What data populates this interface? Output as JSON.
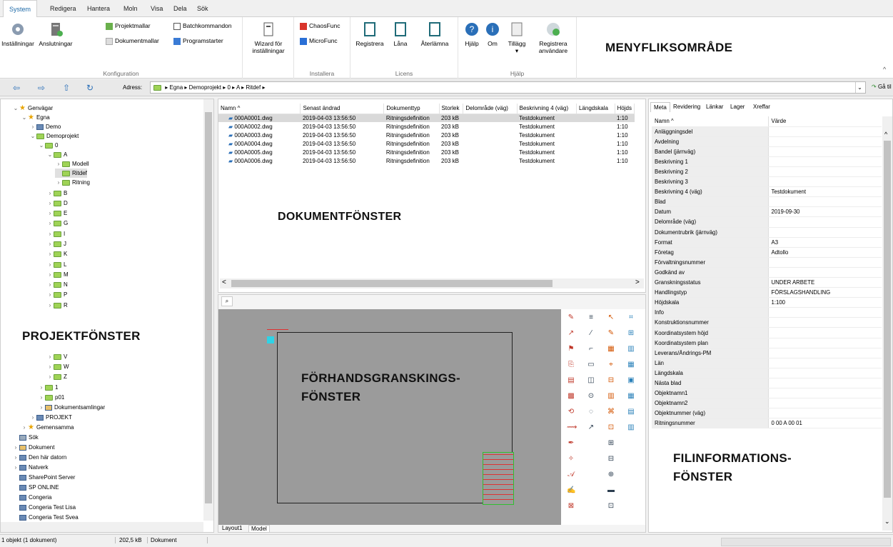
{
  "ribbon": {
    "tabs": [
      "System",
      "Redigera",
      "Hantera",
      "Moln",
      "Visa",
      "Dela",
      "Sök"
    ],
    "groups": {
      "konfiguration": {
        "label": "Konfiguration",
        "installningar": "Inställningar",
        "anslutningar": "Anslutningar",
        "projektmallar": "Projektmallar",
        "dokumentmallar": "Dokumentmallar",
        "batchkommandon": "Batchkommandon",
        "programstarter": "Programstarter"
      },
      "wizard": {
        "line1": "Wizard för",
        "line2": "inställningar"
      },
      "installera": {
        "label": "Installera",
        "chaosfunc": "ChaosFunc",
        "microfunc": "MicroFunc"
      },
      "licens": {
        "label": "Licens",
        "registrera": "Registrera",
        "lana": "Låna",
        "aterlamna": "Återlämna"
      },
      "hjalp": {
        "label": "Hjälp",
        "hjalp": "Hjälp",
        "om": "Om",
        "tillagg": "Tillägg",
        "reg1": "Registrera",
        "reg2": "användare"
      }
    },
    "overlay": "MENYFLIKSOMRÅDE"
  },
  "nav": {
    "address_label": "Adress:",
    "path": [
      "Egna",
      "Demoprojekt",
      "0",
      "A",
      "Ritdef"
    ],
    "goto": "Gå til"
  },
  "tree": {
    "items": [
      "Genvägar",
      "Egna",
      "Demo",
      "Demoprojekt",
      "0",
      "A",
      "Modell",
      "Ritdef",
      "Ritning",
      "B",
      "D",
      "E",
      "G",
      "I",
      "J",
      "K",
      "L",
      "M",
      "N",
      "P",
      "R",
      "V",
      "W",
      "Z",
      "1",
      "p01",
      "Dokumentsamlingar",
      "PROJEKT",
      "Gemensamma",
      "Sök",
      "Dokument",
      "Den här datorn",
      "Natverk",
      "SharePoint Server",
      "SP ONLINE",
      "Congeria",
      "Congeria Test Lisa",
      "Congeria Test Svea"
    ],
    "overlay": "PROJEKTFÖNSTER"
  },
  "docs": {
    "columns": [
      "Namn",
      "Senast ändrad",
      "Dokumenttyp",
      "Storlek",
      "Delområde (väg)",
      "Beskrivning 4 (väg)",
      "Längdskala",
      "Höjds"
    ],
    "rows": [
      [
        "000A0001.dwg",
        "2019-04-03 13:56:50",
        "Ritningsdefinition",
        "203 kB",
        "",
        "Testdokument",
        "",
        "1:10"
      ],
      [
        "000A0002.dwg",
        "2019-04-03 13:56:50",
        "Ritningsdefinition",
        "203 kB",
        "",
        "Testdokument",
        "",
        "1:10"
      ],
      [
        "000A0003.dwg",
        "2019-04-03 13:56:50",
        "Ritningsdefinition",
        "203 kB",
        "",
        "Testdokument",
        "",
        "1:10"
      ],
      [
        "000A0004.dwg",
        "2019-04-03 13:56:50",
        "Ritningsdefinition",
        "203 kB",
        "",
        "Testdokument",
        "",
        "1:10"
      ],
      [
        "000A0005.dwg",
        "2019-04-03 13:56:50",
        "Ritningsdefinition",
        "203 kB",
        "",
        "Testdokument",
        "",
        "1:10"
      ],
      [
        "000A0006.dwg",
        "2019-04-03 13:56:50",
        "Ritningsdefinition",
        "203 kB",
        "",
        "Testdokument",
        "",
        "1:10"
      ]
    ],
    "overlay": "DOKUMENTFÖNSTER"
  },
  "preview": {
    "tabs": [
      "Layout1",
      "Model"
    ],
    "overlay1": "FÖRHANDSGRANSKINGS-",
    "overlay2": "FÖNSTER"
  },
  "meta": {
    "tabs": [
      "Meta",
      "Revidering",
      "Länkar",
      "Lager",
      "Xreffar"
    ],
    "col_name": "Namn",
    "col_value": "Värde",
    "rows": [
      [
        "Anläggningsdel",
        ""
      ],
      [
        "Avdelning",
        ""
      ],
      [
        "Bandel (järnväg)",
        ""
      ],
      [
        "Beskrivning 1",
        ""
      ],
      [
        "Beskrivning 2",
        ""
      ],
      [
        "Beskrivning 3",
        ""
      ],
      [
        "Beskrivning 4 (väg)",
        "Testdokument"
      ],
      [
        "Blad",
        ""
      ],
      [
        "Datum",
        "2019-09-30"
      ],
      [
        "Delområde (väg)",
        ""
      ],
      [
        "Dokumentrubrik (järnväg)",
        ""
      ],
      [
        "Format",
        "A3"
      ],
      [
        "Företag",
        "Adtollo"
      ],
      [
        "Förvaltningsnummer",
        ""
      ],
      [
        "Godkänd av",
        ""
      ],
      [
        "Granskningsstatus",
        "UNDER ARBETE"
      ],
      [
        "Handlingstyp",
        "FÖRSLAGSHANDLING"
      ],
      [
        "Höjdskala",
        "1:100"
      ],
      [
        "Info",
        ""
      ],
      [
        "Konstruktionsnummer",
        ""
      ],
      [
        "Koordinatsystem höjd",
        ""
      ],
      [
        "Koordinatsystem plan",
        ""
      ],
      [
        "Leverans/Ändrings-PM",
        ""
      ],
      [
        "Län",
        ""
      ],
      [
        "Längdskala",
        ""
      ],
      [
        "Nästa blad",
        ""
      ],
      [
        "Objektnamn1",
        ""
      ],
      [
        "Objektnamn2",
        ""
      ],
      [
        "Objektnummer (väg)",
        ""
      ],
      [
        "Ritningsnummer",
        "0 00 A 00 01"
      ]
    ],
    "overlay1": "FILINFORMATIONS-",
    "overlay2": "FÖNSTER"
  },
  "status": {
    "count": "1 objekt (1 dokument)",
    "size": "202,5 kB",
    "type": "Dokument"
  },
  "colors": {
    "accent": "#1e6aa8",
    "folder": "#9fd356",
    "drawing_bg": "#9b9b9b"
  }
}
